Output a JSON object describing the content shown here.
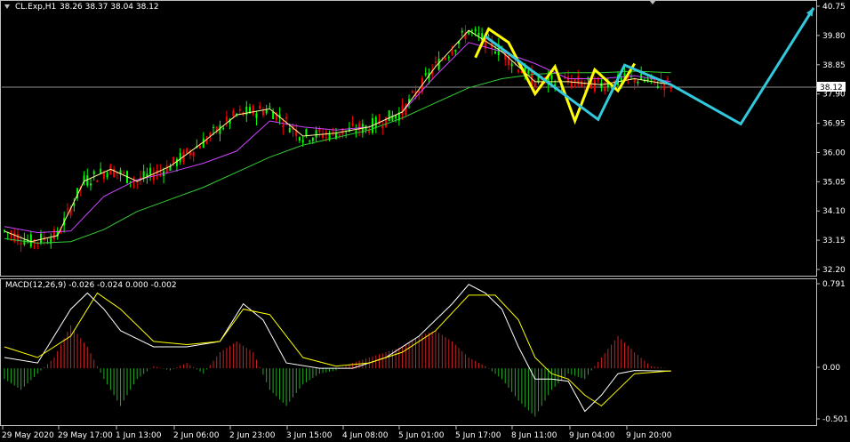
{
  "window": {
    "symbol_label": "CL.Exp,H1",
    "ohlc_label": "38.26 38.37 38.04 38.12"
  },
  "colors": {
    "background": "#000000",
    "bull_candle": "#00ff00",
    "bear_candle": "#ff0000",
    "ma_fast": "#ffff99",
    "ma_mid": "#cc44ff",
    "ma_slow": "#33cc33",
    "zigzag": "#ffff00",
    "forecast": "#33c8dc",
    "macd_line": "#ffffff",
    "signal_line": "#ffff00",
    "hist_pos": "#cc2222",
    "hist_neg": "#22aa22",
    "price_line": "#c0c0c0"
  },
  "chart_data": [
    {
      "type": "line",
      "panel": "price",
      "title": "CL.Exp,H1",
      "ohlc_label": "38.26 38.37 38.04 38.12",
      "current_price_label": "38.12",
      "current_price": 38.12,
      "ylim": [
        31.9,
        40.95
      ],
      "yticks": [
        "40.75",
        "39.80",
        "38.85",
        "37.90",
        "36.95",
        "36.00",
        "35.05",
        "34.10",
        "33.15",
        "32.20"
      ],
      "xticks": [
        "29 May 2020",
        "29 May 17:00",
        "1 Jun 13:00",
        "2 Jun 06:00",
        "2 Jun 23:00",
        "3 Jun 15:00",
        "4 Jun 08:00",
        "5 Jun 01:00",
        "5 Jun 17:00",
        "8 Jun 11:00",
        "9 Jun 04:00",
        "9 Jun 20:00"
      ],
      "x_bar_index_range": [
        0,
        201
      ],
      "grid": false,
      "series": [
        {
          "kind": "ma_slow",
          "points": [
            [
              0,
              33.1
            ],
            [
              10,
              32.95
            ],
            [
              20,
              33.0
            ],
            [
              30,
              33.4
            ],
            [
              40,
              34.0
            ],
            [
              50,
              34.4
            ],
            [
              60,
              34.8
            ],
            [
              70,
              35.3
            ],
            [
              80,
              35.8
            ],
            [
              90,
              36.2
            ],
            [
              100,
              36.45
            ],
            [
              110,
              36.7
            ],
            [
              120,
              37.1
            ],
            [
              130,
              37.6
            ],
            [
              140,
              38.1
            ],
            [
              150,
              38.4
            ],
            [
              160,
              38.55
            ],
            [
              170,
              38.6
            ],
            [
              180,
              38.6
            ],
            [
              190,
              38.65
            ],
            [
              201,
              38.6
            ]
          ]
        },
        {
          "kind": "ma_mid",
          "points": [
            [
              0,
              33.5
            ],
            [
              10,
              33.3
            ],
            [
              20,
              33.35
            ],
            [
              30,
              34.5
            ],
            [
              40,
              35.05
            ],
            [
              50,
              35.3
            ],
            [
              60,
              35.6
            ],
            [
              70,
              36.0
            ],
            [
              80,
              37.0
            ],
            [
              90,
              36.8
            ],
            [
              100,
              36.7
            ],
            [
              110,
              36.8
            ],
            [
              120,
              37.3
            ],
            [
              130,
              38.5
            ],
            [
              140,
              39.6
            ],
            [
              150,
              39.3
            ],
            [
              160,
              38.9
            ],
            [
              170,
              38.4
            ],
            [
              180,
              38.4
            ],
            [
              190,
              38.5
            ],
            [
              201,
              38.3
            ]
          ]
        },
        {
          "kind": "ma_fast",
          "points": [
            [
              0,
              33.35
            ],
            [
              8,
              33.0
            ],
            [
              16,
              33.2
            ],
            [
              24,
              35.0
            ],
            [
              32,
              35.4
            ],
            [
              40,
              35.0
            ],
            [
              50,
              35.5
            ],
            [
              60,
              36.3
            ],
            [
              70,
              37.2
            ],
            [
              80,
              37.4
            ],
            [
              90,
              36.5
            ],
            [
              100,
              36.6
            ],
            [
              110,
              36.8
            ],
            [
              120,
              37.3
            ],
            [
              130,
              38.8
            ],
            [
              140,
              40.0
            ],
            [
              150,
              39.3
            ],
            [
              160,
              38.3
            ],
            [
              170,
              38.3
            ],
            [
              180,
              38.2
            ],
            [
              190,
              38.4
            ],
            [
              201,
              38.2
            ]
          ]
        },
        {
          "kind": "zigzag",
          "points": [
            [
              142,
              39.1
            ],
            [
              146,
              40.05
            ],
            [
              152,
              39.6
            ],
            [
              160,
              37.9
            ],
            [
              166,
              38.8
            ],
            [
              172,
              37.0
            ],
            [
              178,
              38.7
            ],
            [
              185,
              38.0
            ],
            [
              190,
              38.9
            ]
          ]
        },
        {
          "kind": "forecast",
          "points": [
            [
              145,
              39.8
            ],
            [
              179,
              37.05
            ],
            [
              187,
              38.85
            ],
            [
              201,
              38.2
            ],
            [
              222,
              36.9
            ],
            [
              244,
              40.75
            ]
          ]
        }
      ]
    },
    {
      "type": "bar",
      "panel": "macd",
      "title": "MACD(12,26,9) -0.026 -0.024 0.000 -0.002",
      "ylim": [
        -0.52,
        0.82
      ],
      "yticks": [
        "0.791",
        "0.00",
        "-0.501"
      ],
      "x_bar_index_range": [
        0,
        201
      ],
      "histogram": [
        [
          0,
          -0.1
        ],
        [
          5,
          -0.2
        ],
        [
          10,
          -0.05
        ],
        [
          15,
          0.1
        ],
        [
          20,
          0.4
        ],
        [
          25,
          0.2
        ],
        [
          30,
          -0.1
        ],
        [
          35,
          -0.35
        ],
        [
          40,
          -0.1
        ],
        [
          45,
          0.02
        ],
        [
          50,
          -0.02
        ],
        [
          55,
          0.05
        ],
        [
          60,
          -0.05
        ],
        [
          65,
          0.15
        ],
        [
          70,
          0.25
        ],
        [
          75,
          0.15
        ],
        [
          80,
          -0.2
        ],
        [
          85,
          -0.35
        ],
        [
          90,
          -0.15
        ],
        [
          95,
          -0.05
        ],
        [
          100,
          -0.02
        ],
        [
          105,
          0.05
        ],
        [
          110,
          0.1
        ],
        [
          115,
          0.15
        ],
        [
          120,
          0.2
        ],
        [
          125,
          0.3
        ],
        [
          130,
          0.35
        ],
        [
          135,
          0.25
        ],
        [
          140,
          0.1
        ],
        [
          145,
          0.02
        ],
        [
          150,
          -0.1
        ],
        [
          155,
          -0.3
        ],
        [
          160,
          -0.45
        ],
        [
          165,
          -0.2
        ],
        [
          170,
          -0.05
        ],
        [
          175,
          -0.1
        ],
        [
          180,
          0.1
        ],
        [
          185,
          0.3
        ],
        [
          190,
          0.15
        ],
        [
          195,
          0.02
        ],
        [
          200,
          0.0
        ]
      ],
      "macd_line": [
        [
          0,
          0.1
        ],
        [
          10,
          0.05
        ],
        [
          20,
          0.55
        ],
        [
          25,
          0.7
        ],
        [
          30,
          0.55
        ],
        [
          35,
          0.35
        ],
        [
          45,
          0.2
        ],
        [
          55,
          0.2
        ],
        [
          65,
          0.25
        ],
        [
          72,
          0.6
        ],
        [
          78,
          0.45
        ],
        [
          85,
          0.05
        ],
        [
          95,
          0.0
        ],
        [
          105,
          0.0
        ],
        [
          115,
          0.1
        ],
        [
          125,
          0.3
        ],
        [
          135,
          0.6
        ],
        [
          140,
          0.78
        ],
        [
          145,
          0.7
        ],
        [
          150,
          0.55
        ],
        [
          155,
          0.2
        ],
        [
          160,
          -0.1
        ],
        [
          165,
          -0.1
        ],
        [
          170,
          -0.12
        ],
        [
          175,
          -0.4
        ],
        [
          180,
          -0.25
        ],
        [
          185,
          -0.05
        ],
        [
          190,
          -0.02
        ],
        [
          201,
          -0.026
        ]
      ],
      "signal_line": [
        [
          0,
          0.2
        ],
        [
          10,
          0.1
        ],
        [
          20,
          0.3
        ],
        [
          28,
          0.7
        ],
        [
          35,
          0.55
        ],
        [
          45,
          0.25
        ],
        [
          55,
          0.22
        ],
        [
          65,
          0.25
        ],
        [
          72,
          0.55
        ],
        [
          80,
          0.5
        ],
        [
          90,
          0.1
        ],
        [
          100,
          0.02
        ],
        [
          110,
          0.05
        ],
        [
          120,
          0.15
        ],
        [
          130,
          0.35
        ],
        [
          140,
          0.68
        ],
        [
          148,
          0.68
        ],
        [
          155,
          0.45
        ],
        [
          160,
          0.1
        ],
        [
          165,
          -0.05
        ],
        [
          170,
          -0.1
        ],
        [
          175,
          -0.25
        ],
        [
          180,
          -0.35
        ],
        [
          185,
          -0.2
        ],
        [
          190,
          -0.05
        ],
        [
          201,
          -0.024
        ]
      ]
    }
  ]
}
